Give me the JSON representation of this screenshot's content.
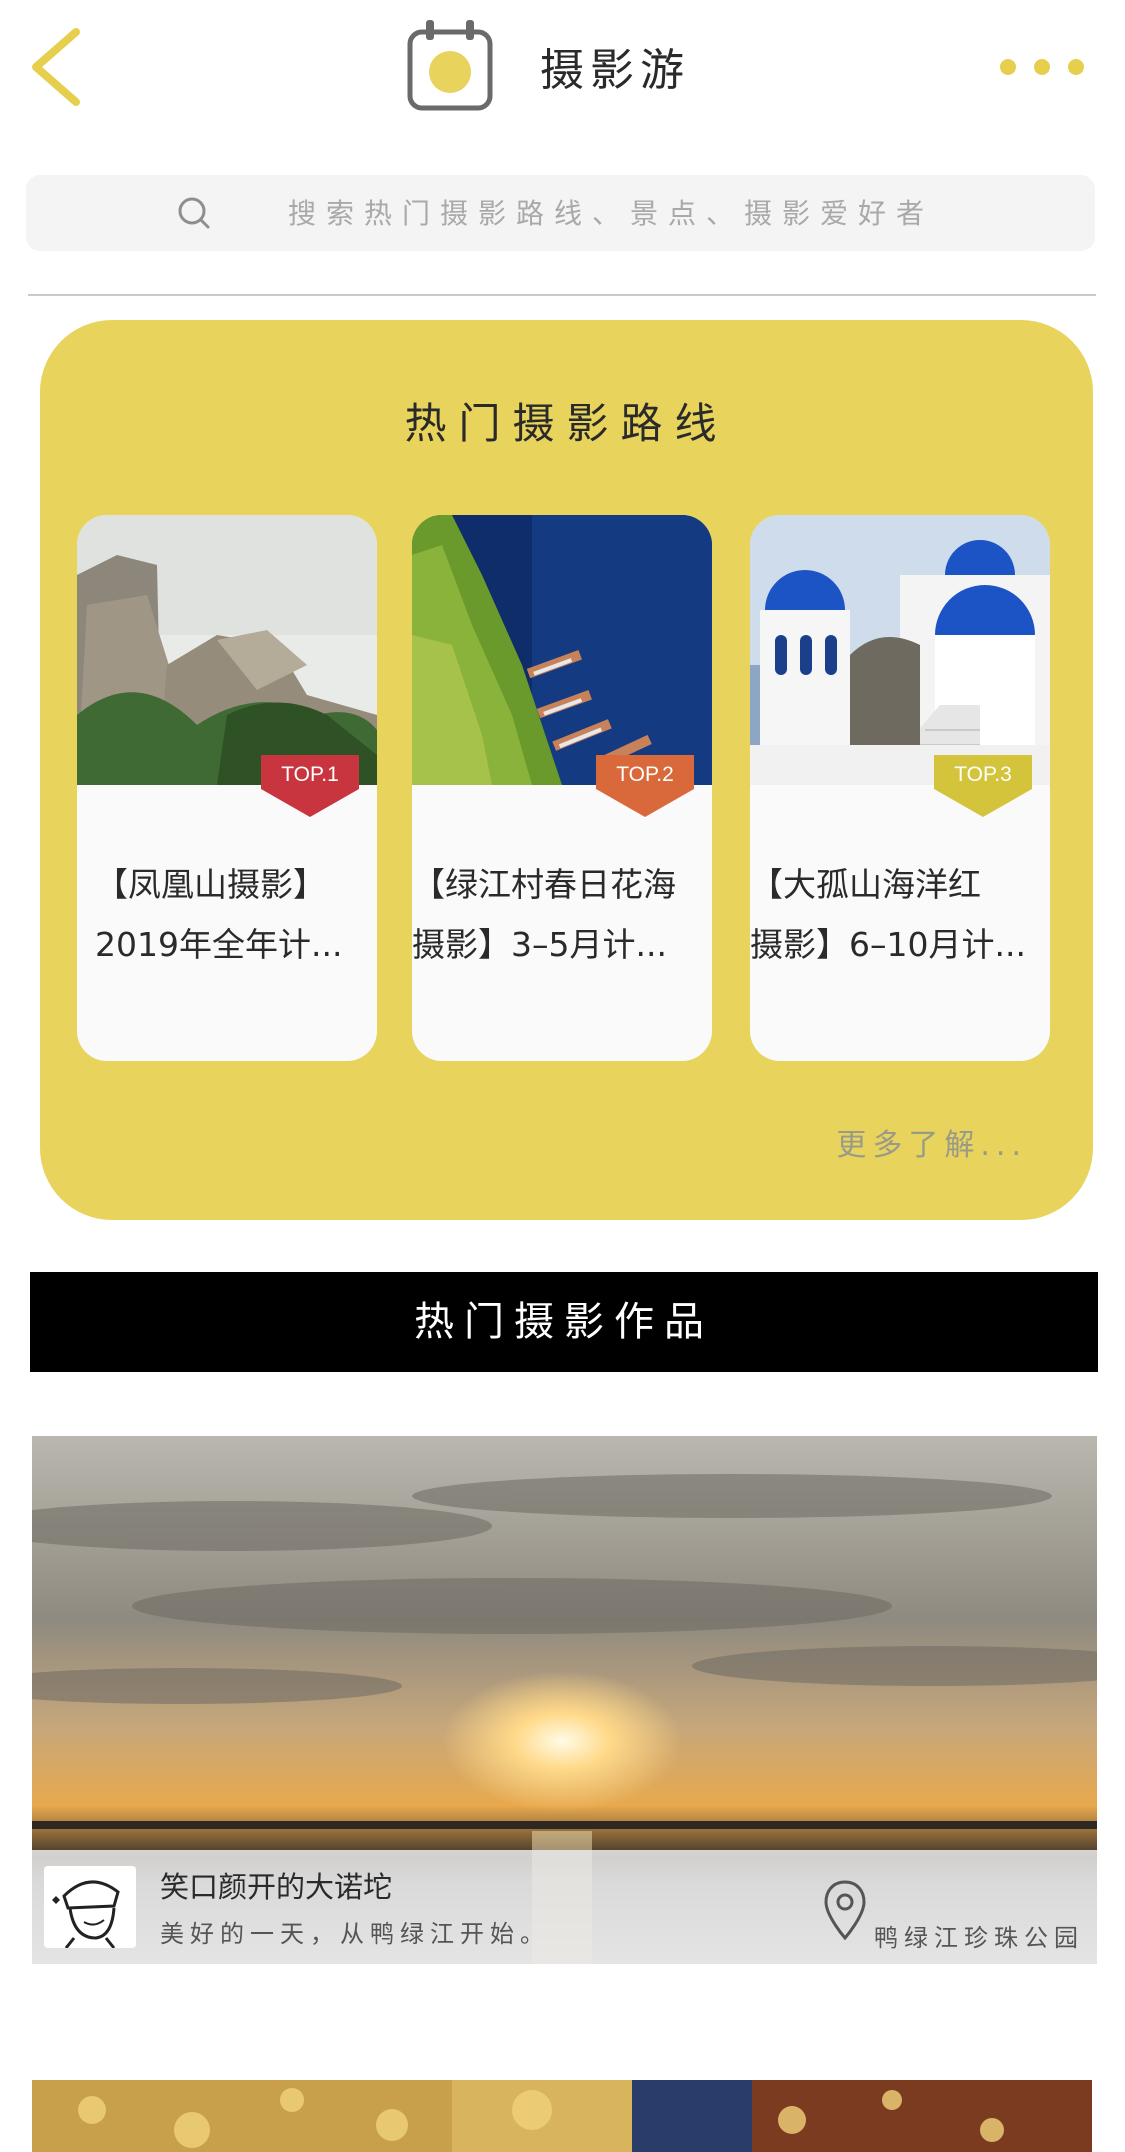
{
  "header": {
    "title": "摄影游",
    "back_icon": "chevron-left-icon",
    "more_icon": "more-dots-icon",
    "accent_color": "#e8d35c"
  },
  "search": {
    "placeholder": "搜索热门摄影路线、景点、摄影爱好者",
    "icon": "search-icon"
  },
  "routes": {
    "title": "热门摄影路线",
    "more_label": "更多了解...",
    "panel_color": "#e8d35c",
    "items": [
      {
        "rank": "TOP.1",
        "caption": " 【凤凰山摄影】\n2019年全年计...",
        "badge_color": "#c9353f",
        "image": "rocky-mountain-in-mist"
      },
      {
        "rank": "TOP.2",
        "caption": "  【绿江村春日花海\n摄影】3–5月计...",
        "badge_color": "#d9693a",
        "image": "boats-on-blue-river"
      },
      {
        "rank": "TOP.3",
        "caption": "  【大孤山海洋红\n摄影】6–10月计...",
        "badge_color": "#d4c43c",
        "image": "white-blue-dome-buildings"
      }
    ]
  },
  "works": {
    "title": "热门摄影作品",
    "items": [
      {
        "author": "笑口颜开的大诺坨",
        "description": "美好的一天，从鸭绿江开始。",
        "location": "鸭绿江珍珠公园",
        "image": "sunset-over-river"
      }
    ]
  }
}
